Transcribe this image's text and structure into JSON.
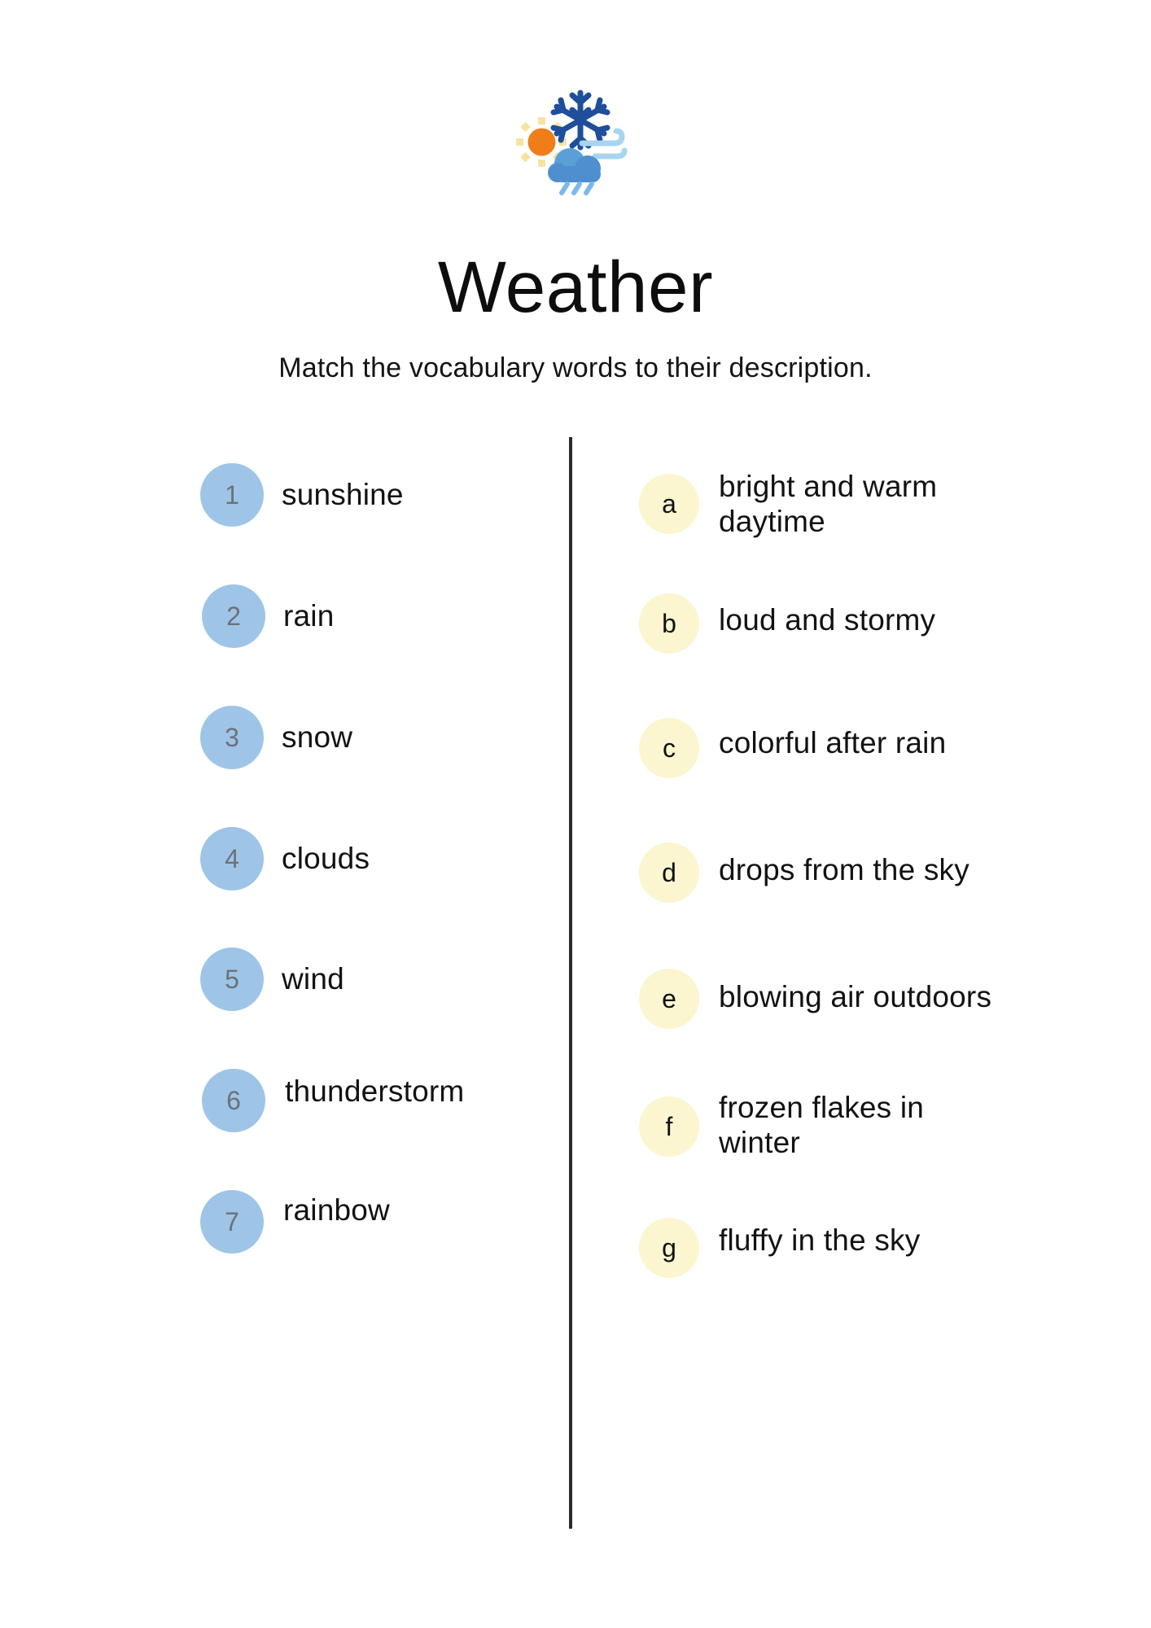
{
  "header": {
    "icon_name": "weather-composite-icon",
    "title": "Weather",
    "subtitle": "Match the vocabulary words to their description.",
    "icon_colors": {
      "snowflake": "#1f4e9c",
      "sun": "#f07d18",
      "sun_rays": "#f7e3a1",
      "cloud": "#4f8fd0",
      "cloud_light": "#5b9fd8",
      "rain": "#7db8e8",
      "wind": "#a8d4f0"
    }
  },
  "colors": {
    "term_badge": "#9EC5E8",
    "term_badge_text": "#6D7178",
    "def_badge": "#FBF6CF",
    "def_badge_text": "#111111",
    "divider": "#2B2B2B",
    "body_text": "#121212",
    "page_background": "#FFFFFF"
  },
  "terms": [
    {
      "number": "1",
      "label": "sunshine"
    },
    {
      "number": "2",
      "label": "rain"
    },
    {
      "number": "3",
      "label": "snow"
    },
    {
      "number": "4",
      "label": "clouds"
    },
    {
      "number": "5",
      "label": "wind"
    },
    {
      "number": "6",
      "label": "thunderstorm"
    },
    {
      "number": "7",
      "label": "rainbow"
    }
  ],
  "definitions": [
    {
      "letter": "a",
      "label": "bright and warm\ndaytime"
    },
    {
      "letter": "b",
      "label": "loud and stormy"
    },
    {
      "letter": "c",
      "label": "colorful after rain"
    },
    {
      "letter": "d",
      "label": "drops from the sky"
    },
    {
      "letter": "e",
      "label": "blowing air outdoors"
    },
    {
      "letter": "f",
      "label": "frozen flakes in\nwinter"
    },
    {
      "letter": "g",
      "label": "fluffy in the sky"
    }
  ]
}
